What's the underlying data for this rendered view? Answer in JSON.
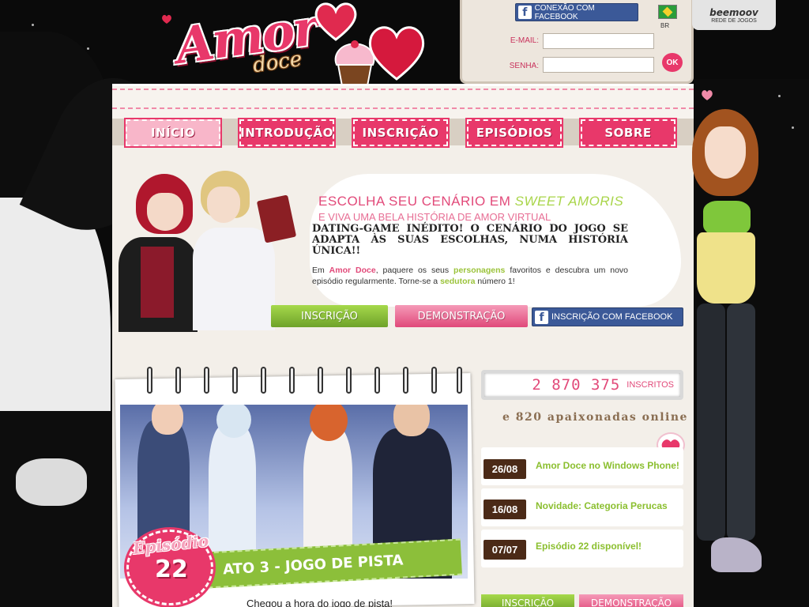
{
  "login": {
    "facebook_button": "CONEXÃO COM FACEBOOK",
    "lang_code": "BR",
    "email_label": "E-MAIL:",
    "email_value": "",
    "password_label": "SENHA:",
    "password_value": "",
    "ok_label": "OK"
  },
  "beemoov": {
    "name": "beemoov",
    "subtitle": "REDE DE JOGOS"
  },
  "logo": {
    "title": "Amor",
    "subtitle": "doce"
  },
  "nav": {
    "tabs": [
      "INÍCIO",
      "INTRODUÇÃO",
      "INSCRIÇÃO",
      "EPISÓDIOS",
      "SOBRE"
    ]
  },
  "hero": {
    "title_prefix": "ESCOLHA SEU CENÁRIO EM ",
    "title_highlight": "SWEET AMORIS",
    "subtitle": "E VIVA UMA BELA HISTÓRIA DE AMOR VIRTUAL",
    "headline": "DATING-GAME INÉDITO! O CENÁRIO DO JOGO SE ADAPTA ÀS SUAS ESCOLHAS, NUMA HISTÓRIA ÚNICA!!",
    "desc_1": "Em ",
    "desc_brand": "Amor Doce",
    "desc_2": ", paquere os seus ",
    "desc_personagens": "personagens",
    "desc_3": " favoritos e descubra um novo episódio regularmente. Torne-se a ",
    "desc_sedutora": "sedutora",
    "desc_4": " número 1!",
    "btn_inscricao": "INSCRIÇÃO",
    "btn_demo": "DEMONSTRAÇÃO",
    "btn_facebook": "INSCRIÇÃO COM FACEBOOK"
  },
  "episode": {
    "label": "Episódio",
    "number": "22",
    "act": "ATO 3 - JOGO DE PISTA",
    "teaser": "Chegou a hora do jogo de pista!"
  },
  "stats": {
    "count": "2 870 375",
    "count_label": "INSCRITOS",
    "online": "e 820 apaixonadas online"
  },
  "news": [
    {
      "date": "26/08",
      "title": "Amor Doce no Windows Phone!"
    },
    {
      "date": "16/08",
      "title": "Novidade: Categoria Perucas"
    },
    {
      "date": "07/07",
      "title": "Episódio 22 disponível!"
    }
  ],
  "bottom_buttons": {
    "inscricao": "INSCRIÇÃO",
    "demo": "DEMONSTRAÇÃO"
  },
  "colors": {
    "brand_pink": "#e8386a",
    "accent_green": "#8cbf3a",
    "facebook_blue": "#3b5998",
    "board_cream": "#f3efe9"
  }
}
